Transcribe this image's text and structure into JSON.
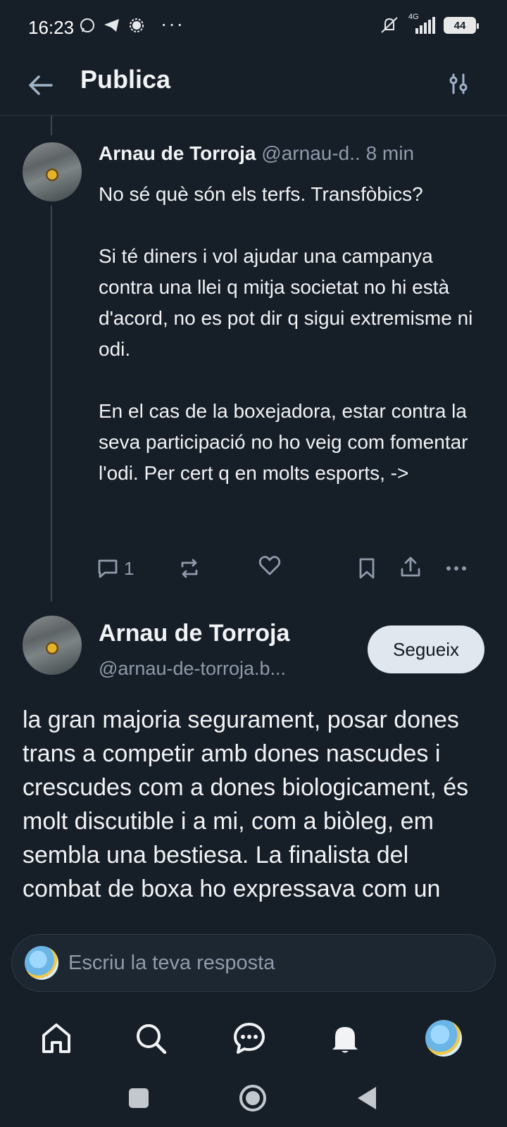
{
  "status_bar": {
    "time": "16:23",
    "network": "4G",
    "battery": "44"
  },
  "header": {
    "title": "Publica"
  },
  "post1": {
    "author": "Arnau de Torroja",
    "handle": "@arnau-d..",
    "time": "8 min",
    "paragraphs": [
      "No sé què són els terfs. Transfòbics?",
      "Si té diners i vol ajudar una campanya contra una llei q mitja societat no hi està d'acord, no es pot dir q sigui extremisme ni odi.",
      "En el cas de la boxejadora, estar contra la seva participació no ho veig com fomentar l'odi. Per cert q en molts esports, ->"
    ],
    "reply_count": "1"
  },
  "post2": {
    "author": "Arnau de Torroja",
    "handle": "@arnau-de-torroja.b...",
    "follow_label": "Segueix",
    "text": "la gran majoria segurament, posar dones trans a competir amb dones nascudes i crescudes com a dones biologicament, és molt discutible i a mi, com a biòleg, em sembla una bestiesa. La finalista del combat de boxa ho expressava com un"
  },
  "composer": {
    "placeholder": "Escriu la teva resposta"
  },
  "icons": {
    "accent": "#f1f3f5",
    "muted": "#8f9bab",
    "background": "#161e27"
  }
}
